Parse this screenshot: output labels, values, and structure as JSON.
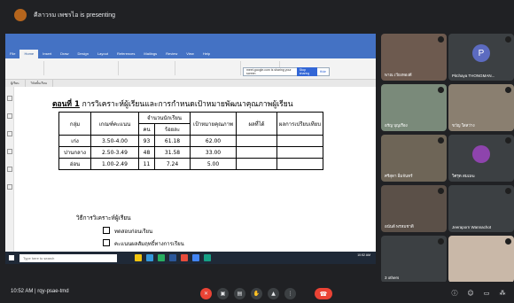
{
  "presenter": {
    "text": "คีลาวรม เพชรไอ is presenting"
  },
  "popup": {
    "text": "meet.google.com is sharing your screen",
    "stop_label": "Stop sharing",
    "hide_label": "Hide"
  },
  "ribbon": {
    "tabs": [
      "File",
      "Home",
      "Insert",
      "Draw",
      "Design",
      "Layout",
      "References",
      "Mailings",
      "Review",
      "View",
      "Help"
    ]
  },
  "doc_tabs": [
    "ผู้เรียน",
    "วิจัยชั้นเรียน"
  ],
  "document": {
    "heading_num": "ตอนที่ 1",
    "heading_rest": " การวิเคราะห์ผู้เรียนและการกำหนดเป้าหมายพัฒนาคุณภาพผู้เรียน",
    "table": {
      "h_group": "กลุ่ม",
      "h_gpa": "เกณฑ์คะแนน",
      "h_count": "จำนวนนักเรียน",
      "h_person": "คน",
      "h_percent": "ร้อยละ",
      "h_target": "เป้าหมายคุณภาพ",
      "h_result": "ผลที่ได้",
      "h_compare": "ผลการเปรียบเทียบ",
      "rows": [
        {
          "group": "เก่ง",
          "gpa": "3.50-4.00",
          "person": "93",
          "percent": "61.18",
          "target": "62.00"
        },
        {
          "group": "ปานกลาง",
          "gpa": "2.50-3.49",
          "person": "48",
          "percent": "31.58",
          "target": "33.00"
        },
        {
          "group": "อ่อน",
          "gpa": "1.00-2.49",
          "person": "11",
          "percent": "7.24",
          "target": "5.00"
        }
      ]
    },
    "method_label": "วิธีการวิเคราะห์ผู้เรียน",
    "check1": "ทดสอบก่อนเรียน",
    "check2": "คะแนนผลสัมฤทธิ์ทางการเรียน"
  },
  "taskbar": {
    "search": "Type here to search",
    "time": "10:52 AM"
  },
  "participants": [
    {
      "name": "พาณ เวียงทองดี",
      "bg": "#6d5a4f",
      "avatar": ""
    },
    {
      "name": "Pitchaya THONGMAN...",
      "bg": "#3c4043",
      "avatar": "P",
      "avatar_color": "#5c6bc0"
    },
    {
      "name": "อรัญ บุญเรือง",
      "bg": "#7a8a7a",
      "avatar": ""
    },
    {
      "name": "ขวัญ ใสสว่าง",
      "bg": "#8a7f70",
      "avatar": ""
    },
    {
      "name": "ศรีสุดา อิ่มจันทร์",
      "bg": "#6e6557",
      "avatar": ""
    },
    {
      "name": "วิศรุต สมเมฆ",
      "bg": "#3c4043",
      "avatar": "",
      "avatar_color": "#8e44ad"
    },
    {
      "name": "อนันต์ พรหมชาติ",
      "bg": "#5b5048",
      "avatar": ""
    },
    {
      "name": "Jeeraporn Wannachot",
      "bg": "#3c4043",
      "avatar": ""
    },
    {
      "name": "3 others",
      "bg": "#3c4043",
      "avatar": ""
    },
    {
      "name": "",
      "bg": "#c9b8a8",
      "avatar": ""
    }
  ],
  "bottom": {
    "time": "10:52 AM",
    "sep": "|",
    "code": "rqy-psae-tmd"
  }
}
